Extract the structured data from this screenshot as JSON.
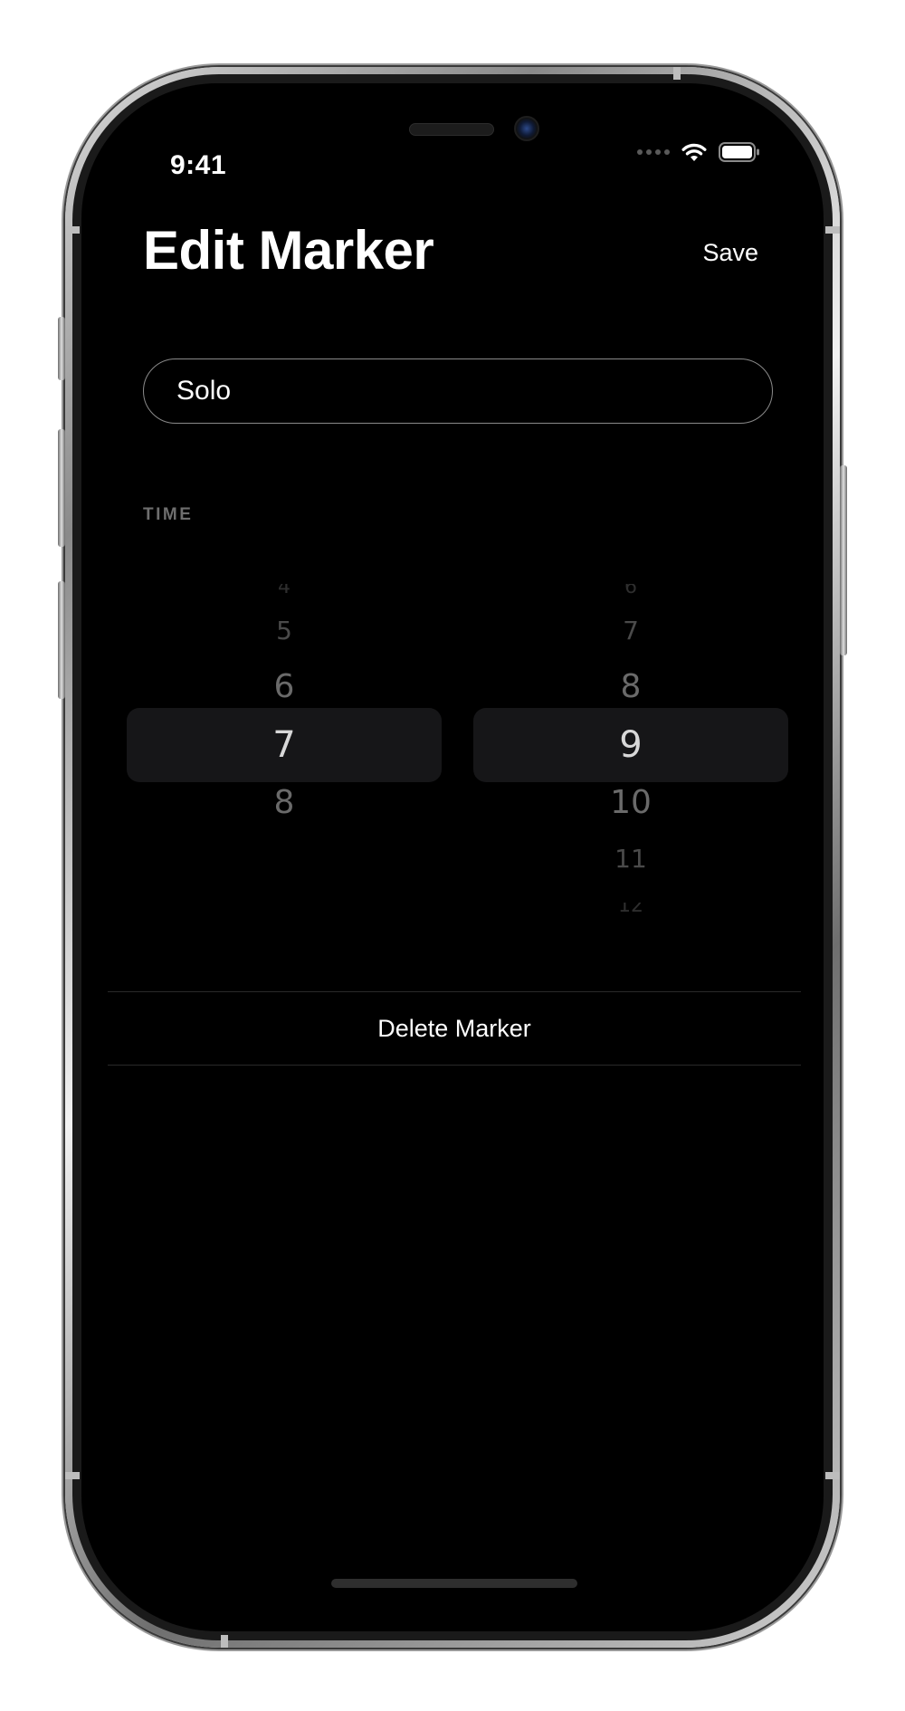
{
  "status_bar": {
    "time": "9:41",
    "icons": [
      "cellular-signal-icon",
      "wifi-icon",
      "battery-icon"
    ]
  },
  "header": {
    "title": "Edit Marker",
    "save_label": "Save"
  },
  "name_field": {
    "value": "Solo",
    "placeholder": ""
  },
  "time_section": {
    "label": "TIME",
    "hours": {
      "items": [
        "4",
        "5",
        "6",
        "7",
        "8"
      ],
      "selected": "7"
    },
    "minutes": {
      "items": [
        "6",
        "7",
        "8",
        "9",
        "10",
        "11",
        "12"
      ],
      "selected": "9"
    }
  },
  "actions": {
    "delete_label": "Delete Marker"
  },
  "colors": {
    "background": "#000000",
    "text": "#ffffff",
    "secondary_text": "#6e6e6e",
    "picker_highlight": "#161618",
    "border": "#8a8a8a"
  }
}
